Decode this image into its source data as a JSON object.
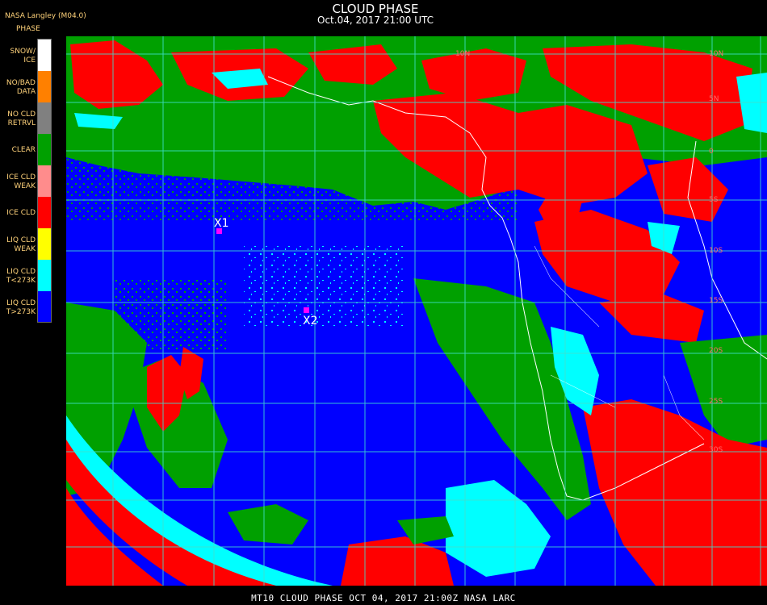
{
  "header": {
    "title": "CLOUD PHASE",
    "timestamp": "Oct.04, 2017 21:00 UTC",
    "producer": "NASA Langley (M04.0)"
  },
  "legend": {
    "header": "PHASE",
    "items": [
      {
        "label": "SNOW/\nICE",
        "color": "#ffffff"
      },
      {
        "label": "NO/BAD\nDATA",
        "color": "#ff8000"
      },
      {
        "label": "NO CLD\nRETRVL",
        "color": "#808080"
      },
      {
        "label": "CLEAR",
        "color": "#00a000"
      },
      {
        "label": "ICE CLD\nWEAK",
        "color": "#ff8c8c"
      },
      {
        "label": "ICE CLD",
        "color": "#ff0000"
      },
      {
        "label": "LIQ CLD\nWEAK",
        "color": "#ffff00"
      },
      {
        "label": "LIQ CLD\nT<273K",
        "color": "#00ffff"
      },
      {
        "label": "LIQ CLD\nT>273K",
        "color": "#0000ff"
      }
    ]
  },
  "map": {
    "grid_labels": [
      "10N",
      "5N",
      "0",
      "5S",
      "10S",
      "15S",
      "20S",
      "25S",
      "30S"
    ],
    "markers": [
      {
        "label": "X1",
        "color": "#ff00ff"
      },
      {
        "label": "X2",
        "color": "#ff00ff"
      }
    ],
    "colors": {
      "ocean_liq": "#0000ff",
      "ice": "#ff0000",
      "clear": "#00a000",
      "liq_cold": "#00ffff",
      "grid": "#40e0d0",
      "coast": "#ffffff"
    }
  },
  "footer": {
    "text": "MT10  CLOUD PHASE   OCT 04, 2017 21:00Z   NASA LARC"
  }
}
